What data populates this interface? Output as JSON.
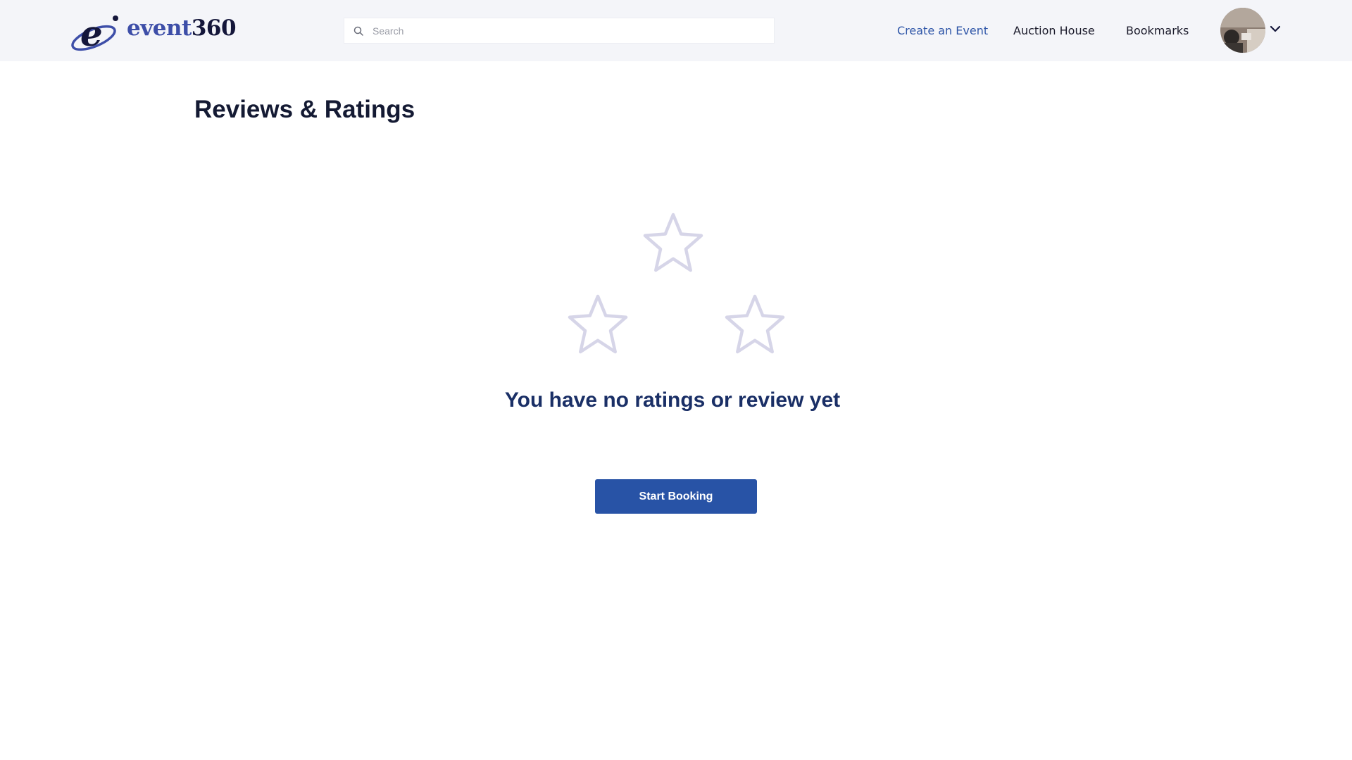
{
  "header": {
    "logo": {
      "text_part1": "event",
      "text_part2": "360",
      "icon": "e-logo-icon"
    },
    "search": {
      "placeholder": "Search",
      "value": "",
      "icon": "search-icon"
    },
    "nav": {
      "create_event": "Create an Event",
      "auction_house": "Auction House",
      "bookmarks": "Bookmarks"
    },
    "user_menu": {
      "avatar": "avatar",
      "icon": "chevron-down-icon"
    }
  },
  "main": {
    "title": "Reviews & Ratings",
    "empty_state": {
      "icon": "star-outline-icon",
      "message": "You have no ratings or review yet",
      "button_label": "Start Booking"
    }
  },
  "colors": {
    "header_bg": "#f4f5f9",
    "accent": "#2853a6",
    "link_active": "#2f56a8",
    "title": "#141a33",
    "message": "#1a2f66",
    "star_outline": "#d6d5e8"
  }
}
